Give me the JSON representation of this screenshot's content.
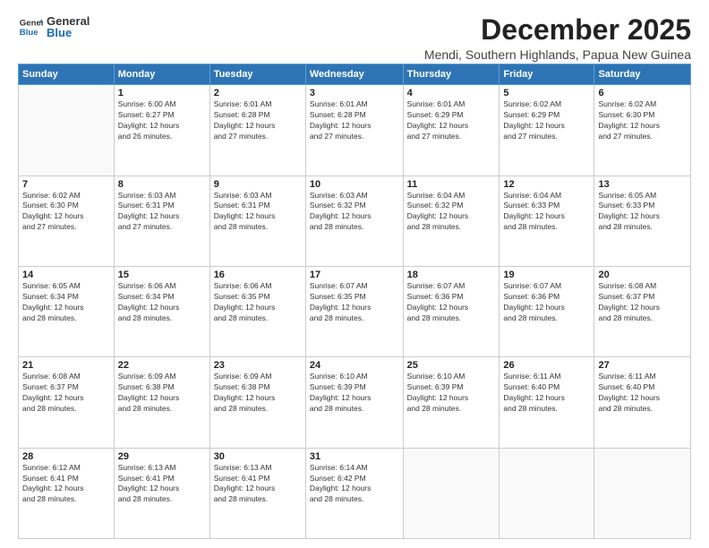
{
  "logo": {
    "general": "General",
    "blue": "Blue"
  },
  "title": "December 2025",
  "subtitle": "Mendi, Southern Highlands, Papua New Guinea",
  "headers": [
    "Sunday",
    "Monday",
    "Tuesday",
    "Wednesday",
    "Thursday",
    "Friday",
    "Saturday"
  ],
  "weeks": [
    [
      {
        "day": "",
        "info": ""
      },
      {
        "day": "1",
        "info": "Sunrise: 6:00 AM\nSunset: 6:27 PM\nDaylight: 12 hours\nand 26 minutes."
      },
      {
        "day": "2",
        "info": "Sunrise: 6:01 AM\nSunset: 6:28 PM\nDaylight: 12 hours\nand 27 minutes."
      },
      {
        "day": "3",
        "info": "Sunrise: 6:01 AM\nSunset: 6:28 PM\nDaylight: 12 hours\nand 27 minutes."
      },
      {
        "day": "4",
        "info": "Sunrise: 6:01 AM\nSunset: 6:29 PM\nDaylight: 12 hours\nand 27 minutes."
      },
      {
        "day": "5",
        "info": "Sunrise: 6:02 AM\nSunset: 6:29 PM\nDaylight: 12 hours\nand 27 minutes."
      },
      {
        "day": "6",
        "info": "Sunrise: 6:02 AM\nSunset: 6:30 PM\nDaylight: 12 hours\nand 27 minutes."
      }
    ],
    [
      {
        "day": "7",
        "info": "Sunrise: 6:02 AM\nSunset: 6:30 PM\nDaylight: 12 hours\nand 27 minutes."
      },
      {
        "day": "8",
        "info": "Sunrise: 6:03 AM\nSunset: 6:31 PM\nDaylight: 12 hours\nand 27 minutes."
      },
      {
        "day": "9",
        "info": "Sunrise: 6:03 AM\nSunset: 6:31 PM\nDaylight: 12 hours\nand 28 minutes."
      },
      {
        "day": "10",
        "info": "Sunrise: 6:03 AM\nSunset: 6:32 PM\nDaylight: 12 hours\nand 28 minutes."
      },
      {
        "day": "11",
        "info": "Sunrise: 6:04 AM\nSunset: 6:32 PM\nDaylight: 12 hours\nand 28 minutes."
      },
      {
        "day": "12",
        "info": "Sunrise: 6:04 AM\nSunset: 6:33 PM\nDaylight: 12 hours\nand 28 minutes."
      },
      {
        "day": "13",
        "info": "Sunrise: 6:05 AM\nSunset: 6:33 PM\nDaylight: 12 hours\nand 28 minutes."
      }
    ],
    [
      {
        "day": "14",
        "info": "Sunrise: 6:05 AM\nSunset: 6:34 PM\nDaylight: 12 hours\nand 28 minutes."
      },
      {
        "day": "15",
        "info": "Sunrise: 6:06 AM\nSunset: 6:34 PM\nDaylight: 12 hours\nand 28 minutes."
      },
      {
        "day": "16",
        "info": "Sunrise: 6:06 AM\nSunset: 6:35 PM\nDaylight: 12 hours\nand 28 minutes."
      },
      {
        "day": "17",
        "info": "Sunrise: 6:07 AM\nSunset: 6:35 PM\nDaylight: 12 hours\nand 28 minutes."
      },
      {
        "day": "18",
        "info": "Sunrise: 6:07 AM\nSunset: 6:36 PM\nDaylight: 12 hours\nand 28 minutes."
      },
      {
        "day": "19",
        "info": "Sunrise: 6:07 AM\nSunset: 6:36 PM\nDaylight: 12 hours\nand 28 minutes."
      },
      {
        "day": "20",
        "info": "Sunrise: 6:08 AM\nSunset: 6:37 PM\nDaylight: 12 hours\nand 28 minutes."
      }
    ],
    [
      {
        "day": "21",
        "info": "Sunrise: 6:08 AM\nSunset: 6:37 PM\nDaylight: 12 hours\nand 28 minutes."
      },
      {
        "day": "22",
        "info": "Sunrise: 6:09 AM\nSunset: 6:38 PM\nDaylight: 12 hours\nand 28 minutes."
      },
      {
        "day": "23",
        "info": "Sunrise: 6:09 AM\nSunset: 6:38 PM\nDaylight: 12 hours\nand 28 minutes."
      },
      {
        "day": "24",
        "info": "Sunrise: 6:10 AM\nSunset: 6:39 PM\nDaylight: 12 hours\nand 28 minutes."
      },
      {
        "day": "25",
        "info": "Sunrise: 6:10 AM\nSunset: 6:39 PM\nDaylight: 12 hours\nand 28 minutes."
      },
      {
        "day": "26",
        "info": "Sunrise: 6:11 AM\nSunset: 6:40 PM\nDaylight: 12 hours\nand 28 minutes."
      },
      {
        "day": "27",
        "info": "Sunrise: 6:11 AM\nSunset: 6:40 PM\nDaylight: 12 hours\nand 28 minutes."
      }
    ],
    [
      {
        "day": "28",
        "info": "Sunrise: 6:12 AM\nSunset: 6:41 PM\nDaylight: 12 hours\nand 28 minutes."
      },
      {
        "day": "29",
        "info": "Sunrise: 6:13 AM\nSunset: 6:41 PM\nDaylight: 12 hours\nand 28 minutes."
      },
      {
        "day": "30",
        "info": "Sunrise: 6:13 AM\nSunset: 6:41 PM\nDaylight: 12 hours\nand 28 minutes."
      },
      {
        "day": "31",
        "info": "Sunrise: 6:14 AM\nSunset: 6:42 PM\nDaylight: 12 hours\nand 28 minutes."
      },
      {
        "day": "",
        "info": ""
      },
      {
        "day": "",
        "info": ""
      },
      {
        "day": "",
        "info": ""
      }
    ]
  ]
}
